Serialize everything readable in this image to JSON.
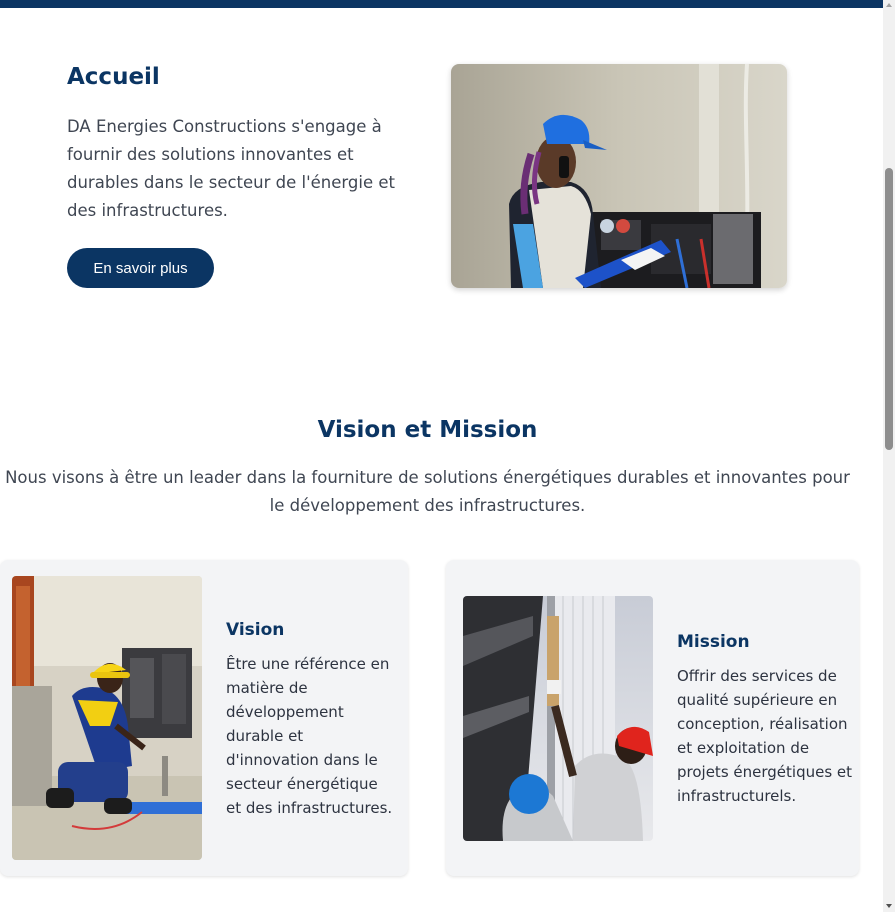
{
  "hero": {
    "title": "Accueil",
    "text": "DA Energies Constructions s'engage à fournir des solutions innovantes et durables dans le secteur de l'énergie et des infrastructures.",
    "button_label": "En savoir plus"
  },
  "vision_mission": {
    "title": "Vision et Mission",
    "intro": "Nous visons à être un leader dans la fourniture de solutions énergétiques durables et innovantes pour le développement des infrastructures.",
    "cards": [
      {
        "title": "Vision",
        "text": "Être une référence en matière de développement durable et d'innovation dans le secteur énergétique et des infrastructures."
      },
      {
        "title": "Mission",
        "text": "Offrir des services de qualité supérieure en conception, réalisation et exploitation de projets énergétiques et infrastructurels."
      }
    ]
  },
  "colors": {
    "brand_navy": "#0b3563",
    "card_bg": "#f3f4f6",
    "text": "#3f4652"
  }
}
